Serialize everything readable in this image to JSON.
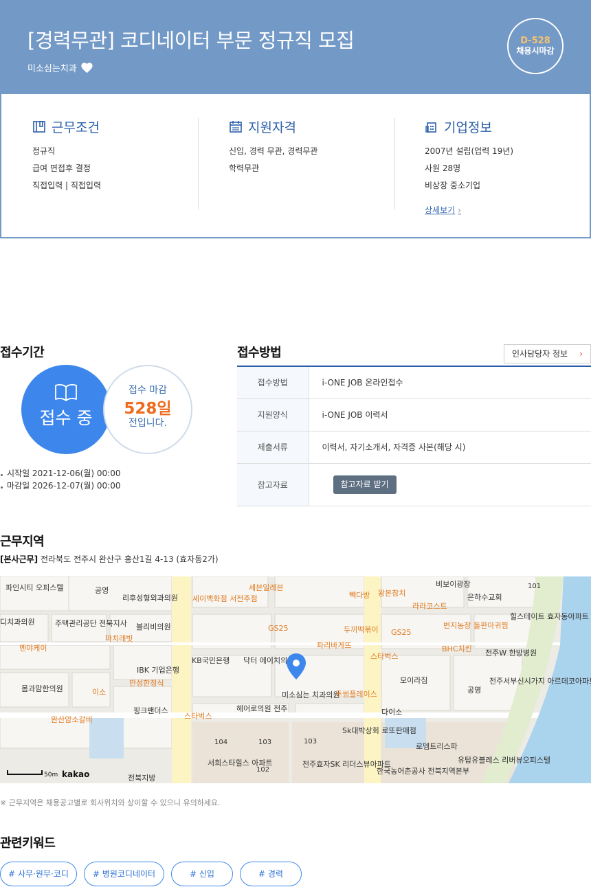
{
  "header": {
    "title": "[경력무관] 코디네이터 부문 정규직 모집",
    "company": "미소심는치과",
    "dday": "D-528",
    "deadline_type": "채용시마감"
  },
  "summary": {
    "conditions": {
      "title": "근무조건",
      "items": [
        "정규직",
        "급여 면접후 결정",
        "직접입력 | 직접입력"
      ]
    },
    "qualifications": {
      "title": "지원자격",
      "items": [
        "신입, 경력 무관, 경력무관",
        "학력무관"
      ]
    },
    "company_info": {
      "title": "기업정보",
      "items": [
        "2007년 설립(업력 19년)",
        "사원 28명",
        "비상장 중소기업"
      ],
      "more": "상세보기"
    }
  },
  "period": {
    "title": "접수기간",
    "status": "접수 중",
    "remain_prefix": "접수 마감",
    "remain_days": "528일",
    "remain_suffix": "전입니다.",
    "start": "시작일 2021-12-06(월) 00:00",
    "end": "마감일 2026-12-07(월) 00:00"
  },
  "method": {
    "title": "접수방법",
    "hr_button": "인사담당자 정보",
    "rows": [
      {
        "key": "접수방법",
        "value": "i-ONE JOB 온라인접수"
      },
      {
        "key": "지원양식",
        "value": "i-ONE JOB 이력서"
      },
      {
        "key": "제출서류",
        "value": "이력서, 자기소개서, 자격증 사본(해당 시)"
      },
      {
        "key": "참고자료",
        "button": "참고자료 받기"
      }
    ]
  },
  "location": {
    "title": "근무지역",
    "tag": "[본사근무]",
    "address": "전라북도 전주시 완산구 홍산1길 4-13 (효자동2가)",
    "note": "※ 근무지역은 채용공고별로 회사위치와 상이할 수 있으니 유의하세요.",
    "map": {
      "scale": "50m",
      "brand": "kakao",
      "labels": [
        "파인시티 오피스텔",
        "공영",
        "리후성형외과의원",
        "세이백화점 서전주점",
        "세븐일레븐",
        "빽다방",
        "왕본참치",
        "비보이광장",
        "은하수교회",
        "디치과의원",
        "주택관리공단 전북지사",
        "블리비의원",
        "GS25",
        "두끼떡볶이",
        "GS25",
        "라라코스트",
        "번지농장 돌판아귀찜",
        "힐스테이트 효자동아파트",
        "멘야케이",
        "마치래빗",
        "IBK 기업은행",
        "KB국민은행",
        "닥터 에이치의원",
        "파리바게뜨",
        "스타벅스",
        "BHC치킨",
        "전주W 한방병원",
        "몸과맘한의원",
        "이소",
        "만성한정식",
        "미소심는 치과의원",
        "모이라짐",
        "공영",
        "전주서부신시가지 아르데코아파트",
        "완산암소갈비",
        "핑크팬더스",
        "스타벅스",
        "헤어로의원 전주",
        "투썸플레이스",
        "다이소",
        "Sk대박상회 로또판매점",
        "로뎀트리스파",
        "유탑유블레스 리버뷰오피스텔",
        "서희스타힐스 아파트",
        "전주효자SK 리더스뷰아파트",
        "한국농어촌공사 전북지역본부",
        "전북지방",
        "101",
        "104",
        "103",
        "103",
        "102"
      ]
    }
  },
  "keywords": {
    "title": "관련키워드",
    "items": [
      "# 사무·원무·코디",
      "# 병원코디네이터",
      "# 신입",
      "# 경력"
    ]
  }
}
